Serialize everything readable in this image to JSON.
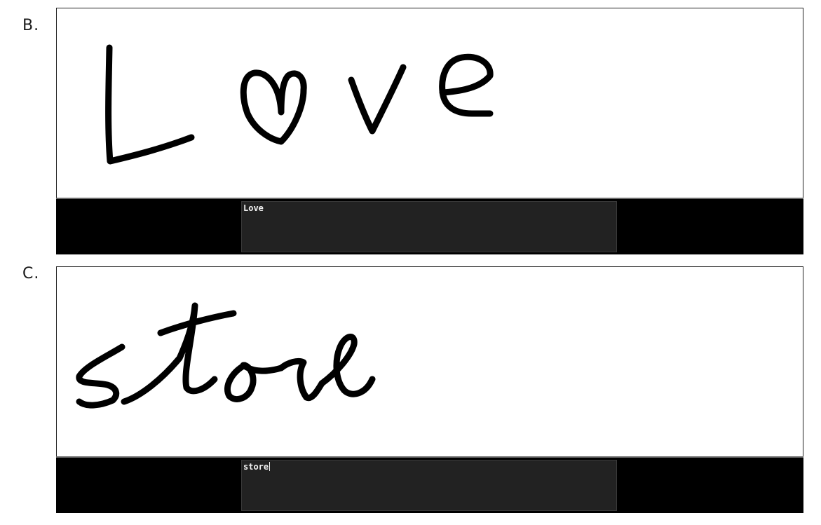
{
  "panels": [
    {
      "label": "B.",
      "recognized_text": "Love",
      "ink_text": "Love",
      "caret_visible": false
    },
    {
      "label": "C.",
      "recognized_text": "store",
      "ink_text": "store",
      "caret_visible": true
    }
  ],
  "colors": {
    "ink": "#000000",
    "canvas_background": "#ffffff",
    "bar_background": "#000000",
    "textbox_background": "#222222",
    "textbox_text": "#f2f2f2"
  }
}
